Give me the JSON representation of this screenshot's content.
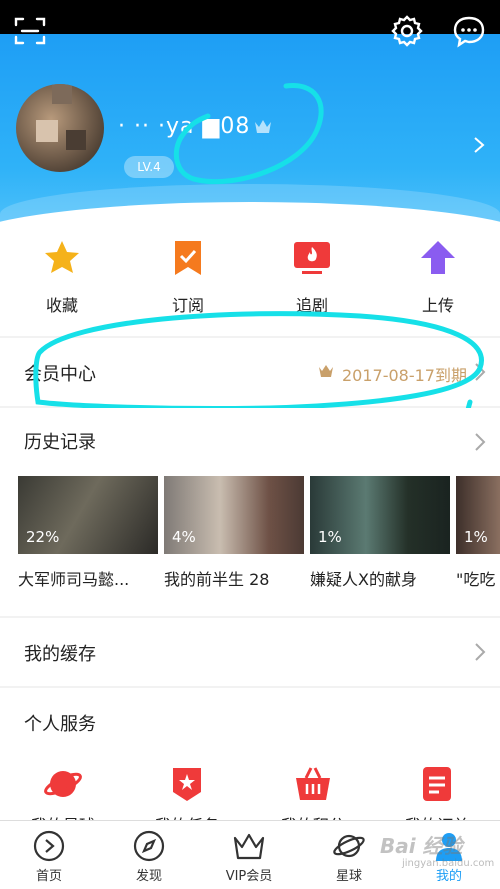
{
  "header": {
    "username": "· ·· ·ya ▆08",
    "level": "LV.4"
  },
  "quick_actions": [
    {
      "label": "收藏",
      "icon": "star-icon",
      "color": "#f5b21a"
    },
    {
      "label": "订阅",
      "icon": "bookmark-check-icon",
      "color": "#f57a1e"
    },
    {
      "label": "追剧",
      "icon": "tv-fire-icon",
      "color": "#ef3a3a"
    },
    {
      "label": "上传",
      "icon": "upload-arrow-icon",
      "color": "#8a5cf0"
    }
  ],
  "vip": {
    "title": "会员中心",
    "expiry": "2017-08-17到期"
  },
  "history": {
    "title": "历史记录",
    "items": [
      {
        "title": "大军师司马懿...",
        "progress": "22%"
      },
      {
        "title": "我的前半生 28",
        "progress": "4%"
      },
      {
        "title": "嫌疑人X的献身",
        "progress": "1%"
      },
      {
        "title": "\"吃吃",
        "progress": "1%"
      }
    ]
  },
  "cache": {
    "title": "我的缓存"
  },
  "services": {
    "title": "个人服务",
    "items": [
      {
        "label": "我的星球",
        "icon": "planet-icon"
      },
      {
        "label": "我的任务",
        "icon": "task-badge-icon"
      },
      {
        "label": "我的积分",
        "icon": "basket-icon"
      },
      {
        "label": "我的订单",
        "icon": "order-doc-icon"
      }
    ]
  },
  "tabbar": [
    {
      "label": "首页",
      "icon": "play-circle-icon"
    },
    {
      "label": "发现",
      "icon": "compass-icon"
    },
    {
      "label": "VIP会员",
      "icon": "crown-icon"
    },
    {
      "label": "星球",
      "icon": "planet-icon"
    },
    {
      "label": "我的",
      "icon": "person-icon",
      "active": true
    }
  ],
  "watermark": {
    "text": "Bai 经验",
    "sub": "jingyan.baidu.com"
  },
  "colors": {
    "header_blue": "#1e9ef5",
    "vip_gold": "#c9a06a",
    "annotation_cyan": "#16e0e8"
  }
}
